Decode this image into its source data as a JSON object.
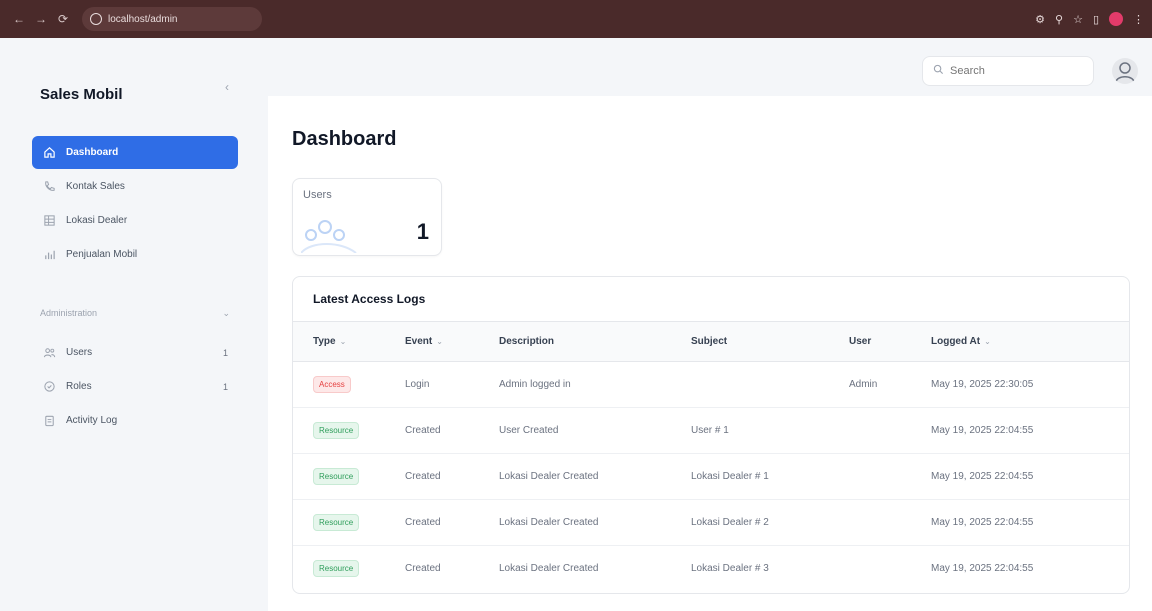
{
  "browser": {
    "url": "localhost/admin",
    "back_icon": "arrow-left-icon",
    "forward_icon": "arrow-right-icon",
    "reload_icon": "reload-icon"
  },
  "sidebar": {
    "brand": "Sales Mobil",
    "items": [
      {
        "label": "Dashboard",
        "icon": "home-icon",
        "active": true
      },
      {
        "label": "Kontak Sales",
        "icon": "phone-icon"
      },
      {
        "label": "Lokasi Dealer",
        "icon": "building-icon"
      },
      {
        "label": "Penjualan Mobil",
        "icon": "chart-icon"
      }
    ],
    "group_label": "Administration",
    "admin_items": [
      {
        "label": "Users",
        "icon": "users-icon",
        "badge": "1"
      },
      {
        "label": "Roles",
        "icon": "shield-icon",
        "badge": "1"
      },
      {
        "label": "Activity Log",
        "icon": "clipboard-icon"
      }
    ]
  },
  "topbar": {
    "search_placeholder": "Search"
  },
  "main": {
    "title": "Dashboard",
    "stat": {
      "label": "Users",
      "value": "1"
    },
    "logs": {
      "heading": "Latest Access Logs",
      "columns": [
        "Type",
        "Event",
        "Description",
        "Subject",
        "User",
        "Logged At"
      ],
      "rows": [
        {
          "type": "Access",
          "event": "Login",
          "description": "Admin logged in",
          "subject": "",
          "user": "Admin",
          "logged_at": "May 19, 2025 22:30:05"
        },
        {
          "type": "Resource",
          "event": "Created",
          "description": "User Created",
          "subject": "User # 1",
          "user": "",
          "logged_at": "May 19, 2025 22:04:55"
        },
        {
          "type": "Resource",
          "event": "Created",
          "description": "Lokasi Dealer Created",
          "subject": "Lokasi Dealer # 1",
          "user": "",
          "logged_at": "May 19, 2025 22:04:55"
        },
        {
          "type": "Resource",
          "event": "Created",
          "description": "Lokasi Dealer Created",
          "subject": "Lokasi Dealer # 2",
          "user": "",
          "logged_at": "May 19, 2025 22:04:55"
        },
        {
          "type": "Resource",
          "event": "Created",
          "description": "Lokasi Dealer Created",
          "subject": "Lokasi Dealer # 3",
          "user": "",
          "logged_at": "May 19, 2025 22:04:55"
        }
      ]
    }
  },
  "colors": {
    "accent": "#2f6de6",
    "chrome": "#4a2a2a",
    "access_badge": "#e53e3e",
    "resource_badge": "#2f9e5b"
  }
}
